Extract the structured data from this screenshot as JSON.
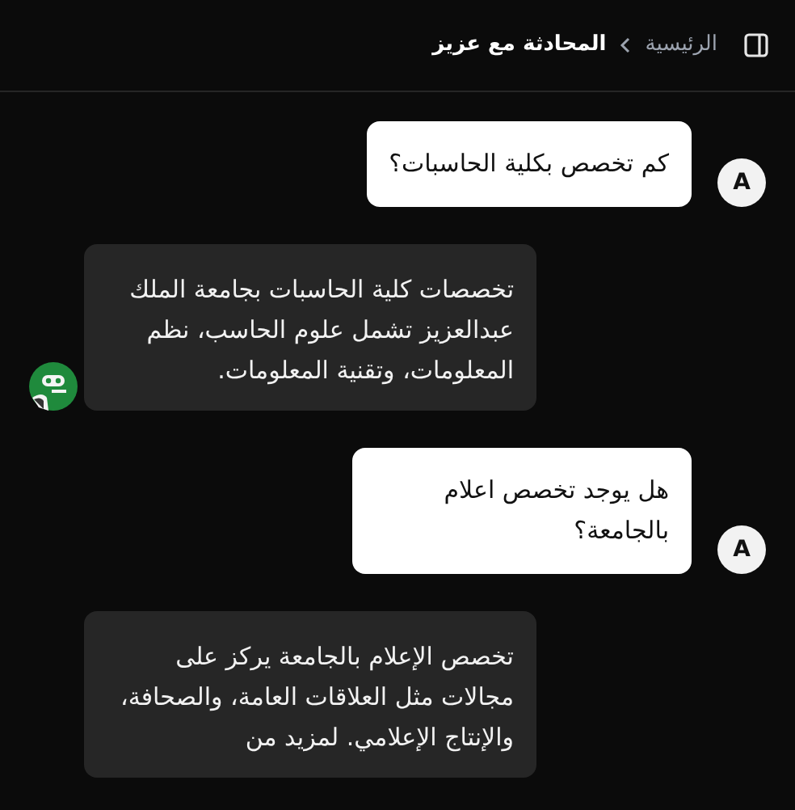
{
  "header": {
    "breadcrumb": [
      {
        "label": "الرئيسية",
        "current": false
      },
      {
        "label": "المحادثة مع عزيز",
        "current": true
      }
    ]
  },
  "messages": [
    {
      "kind": "user",
      "avatar": "A",
      "text": "كم تخصص بكلية الحاسبات؟"
    },
    {
      "kind": "bot",
      "has_avatar": true,
      "text": "تخصصات كلية الحاسبات بجامعة الملك عبدالعزيز تشمل علوم الحاسب، نظم المعلومات، وتقنية المعلومات."
    },
    {
      "kind": "user",
      "avatar": "A",
      "text": "هل يوجد تخصص اعلام بالجامعة؟"
    },
    {
      "kind": "bot",
      "has_avatar": false,
      "text": "تخصص الإعلام بالجامعة يركز على مجالات مثل العلاقات العامة، والصحافة، والإنتاج الإعلامي. لمزيد من"
    }
  ]
}
